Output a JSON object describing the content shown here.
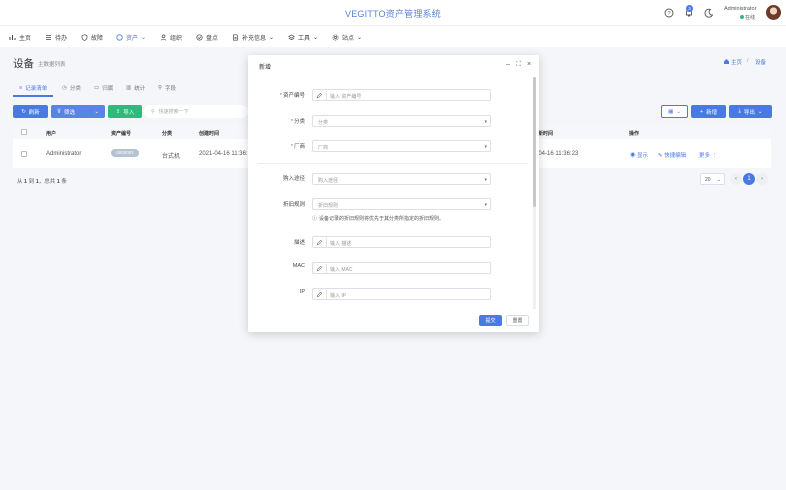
{
  "app_title": "VEGITTO资产管理系统",
  "header": {
    "notification_count": "3",
    "user_name": "Administrator",
    "user_status": "在线"
  },
  "nav": {
    "items": [
      {
        "label": "主页",
        "icon": "bar-chart-icon"
      },
      {
        "label": "待办",
        "icon": "list-icon"
      },
      {
        "label": "故障",
        "icon": "shield-icon"
      },
      {
        "label": "资产",
        "icon": "circle-icon"
      },
      {
        "label": "组织",
        "icon": "user-icon"
      },
      {
        "label": "盘点",
        "icon": "check-circle-icon"
      },
      {
        "label": "补充信息",
        "icon": "document-icon"
      },
      {
        "label": "工具",
        "icon": "layers-icon"
      },
      {
        "label": "站点",
        "icon": "gear-icon"
      }
    ],
    "active_label": "资产"
  },
  "page": {
    "title": "设备",
    "subtitle": "主数据列表",
    "breadcrumb_home": "主页",
    "breadcrumb_sep": "/",
    "breadcrumb_current": "设备"
  },
  "tabs": [
    "记录清单",
    "分类",
    "归属",
    "统计",
    "字段"
  ],
  "toolbar": {
    "refresh": "刷新",
    "filter": "筛选",
    "import": "导入",
    "search_placeholder": "快速搜索一下",
    "create": "新增",
    "export": "导出"
  },
  "table": {
    "columns": [
      "用户",
      "资产编号",
      "分类",
      "创建时间",
      "更新时间",
      "操作"
    ],
    "rows": [
      {
        "user": "Administrator",
        "asset_no": "0000001",
        "category": "台式机",
        "created": "2021-04-16 11:36:23",
        "updated": "2021-04-16 11:36:23"
      }
    ],
    "actions": [
      "显示",
      "快捷编辑",
      "更多"
    ]
  },
  "footer": {
    "prefix": "从",
    "from": "1",
    "to_text": "到",
    "to": "1",
    "total_text": "，总共",
    "total": "1",
    "suffix": "条",
    "page_size": "20",
    "current_page": "1",
    "prev": "‹",
    "next": "›"
  },
  "modal": {
    "title": "新增",
    "fields": [
      {
        "label": "资产编号",
        "placeholder": "输入 资产编号",
        "required": true,
        "type": "text"
      },
      {
        "label": "分类",
        "placeholder": "分类",
        "required": true,
        "type": "select"
      },
      {
        "label": "厂商",
        "placeholder": "厂商",
        "required": true,
        "type": "select"
      },
      {
        "label": "购入途径",
        "placeholder": "购入途径",
        "required": false,
        "type": "select"
      },
      {
        "label": "折旧规则",
        "placeholder": "折旧规则",
        "required": false,
        "type": "select"
      },
      {
        "label": "描述",
        "placeholder": "输入 描述",
        "required": false,
        "type": "text"
      },
      {
        "label": "MAC",
        "placeholder": "输入 MAC",
        "required": false,
        "type": "text"
      },
      {
        "label": "IP",
        "placeholder": "输入 IP",
        "required": false,
        "type": "text"
      }
    ],
    "hint": "设备记录的折旧规则将优先于其分类所指定的折旧规则。",
    "submit": "提交",
    "reset": "重置"
  },
  "colors": {
    "primary": "#4b79e3",
    "success": "#2fb97a",
    "required": "#e04545"
  }
}
